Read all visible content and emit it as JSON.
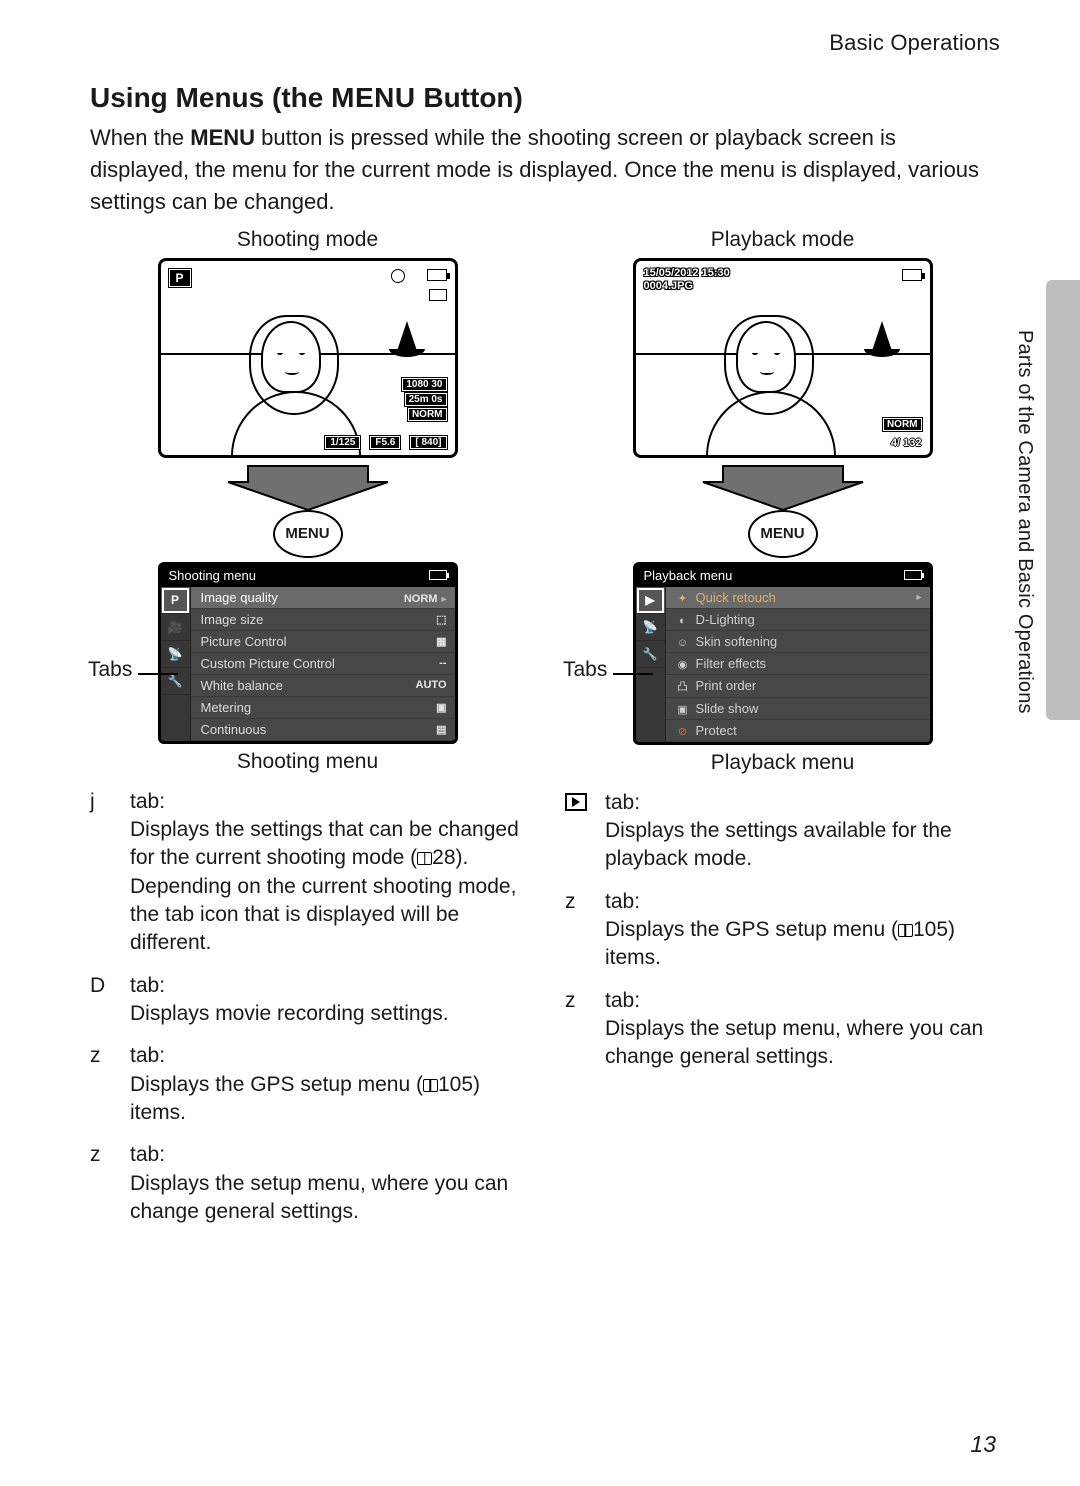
{
  "header": {
    "section": "Basic Operations"
  },
  "title": {
    "pre": "Using Menus (the ",
    "menu": "MENU",
    "post": " Button)"
  },
  "intro": {
    "a": "When the ",
    "b": "MENU",
    "c": " button is pressed while the shooting screen or playback screen is displayed, the menu for the current mode is displayed. Once the menu is displayed, various settings can be changed."
  },
  "side": {
    "label": "Parts of the Camera and Basic Operations"
  },
  "page": "13",
  "shooting": {
    "mode_label": "Shooting mode",
    "tabs_label": "Tabs",
    "menu_btn": "MENU",
    "lcd": {
      "pbadge": "P",
      "res": "1080 30",
      "time": "25m 0s",
      "norm": "NORM",
      "shutter": "1/125",
      "fnum": "F5.6",
      "remain": "[  840]"
    },
    "menu_title": "Shooting menu",
    "menu_label": "Shooting menu",
    "items": [
      {
        "label": "Image quality",
        "val": "NORM"
      },
      {
        "label": "Image size",
        "val": ""
      },
      {
        "label": "Picture Control",
        "val": ""
      },
      {
        "label": "Custom Picture Control",
        "val": "--"
      },
      {
        "label": "White balance",
        "val": "AUTO"
      },
      {
        "label": "Metering",
        "val": ""
      },
      {
        "label": "Continuous",
        "val": ""
      }
    ],
    "tabs_desc": [
      {
        "sym": "j",
        "head": "tab:",
        "body": "Displays the settings that can be changed for the current shooting mode (",
        "ref": "28",
        "body2": "). Depending on the current shooting mode, the tab icon that is displayed will be different."
      },
      {
        "sym": "D",
        "head": "tab:",
        "body": "Displays movie recording settings."
      },
      {
        "sym": "z",
        "head": "tab:",
        "body": "Displays the GPS setup menu (",
        "ref": "105",
        "body2": ") items."
      },
      {
        "sym": "z",
        "head": "tab:",
        "body": "Displays the setup menu, where you can change general settings."
      }
    ]
  },
  "playback": {
    "mode_label": "Playback mode",
    "tabs_label": "Tabs",
    "menu_btn": "MENU",
    "lcd": {
      "ts1": "15/05/2012 15:30",
      "ts2": "0004.JPG",
      "norm": "NORM",
      "count": "4/ 132"
    },
    "menu_title": "Playback menu",
    "menu_label": "Playback menu",
    "items": [
      {
        "label": "Quick retouch",
        "gold": true
      },
      {
        "label": "D-Lighting"
      },
      {
        "label": "Skin softening"
      },
      {
        "label": "Filter effects"
      },
      {
        "label": "Print order"
      },
      {
        "label": "Slide show"
      },
      {
        "label": "Protect"
      }
    ],
    "tabs_desc": [
      {
        "sym": "play",
        "head": "tab:",
        "body": "Displays the settings available for the playback mode."
      },
      {
        "sym": "z",
        "head": "tab:",
        "body": "Displays the GPS setup menu (",
        "ref": "105",
        "body2": ") items."
      },
      {
        "sym": "z",
        "head": "tab:",
        "body": "Displays the setup menu, where you can change general settings."
      }
    ]
  }
}
